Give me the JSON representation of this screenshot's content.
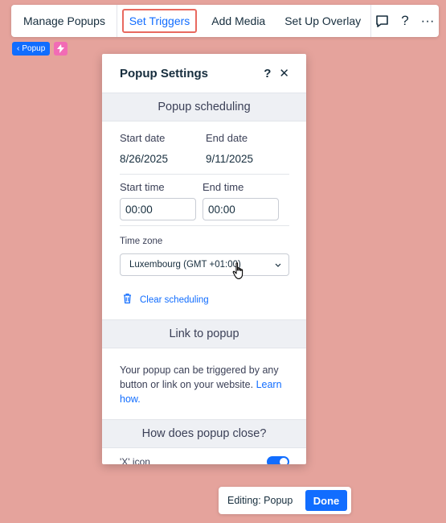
{
  "toolbar": {
    "manage_popups": "Manage Popups",
    "set_triggers": "Set Triggers",
    "add_media": "Add Media",
    "set_up_overlay": "Set Up Overlay",
    "help": "?",
    "more": "···"
  },
  "breadcrumb": {
    "label": "Popup"
  },
  "panel": {
    "title": "Popup Settings",
    "help": "?",
    "close": "✕",
    "scheduling": {
      "heading": "Popup scheduling",
      "start_date_label": "Start date",
      "start_date_value": "8/26/2025",
      "end_date_label": "End date",
      "end_date_value": "9/11/2025",
      "start_time_label": "Start time",
      "start_time_value": "00:00",
      "end_time_label": "End time",
      "end_time_value": "00:00",
      "time_zone_label": "Time zone",
      "time_zone_value": "Luxembourg (GMT +01:00)",
      "clear_label": "Clear scheduling"
    },
    "link": {
      "heading": "Link to popup",
      "description": "Your popup can be triggered by any button or link on your website.",
      "learn_how": "Learn how."
    },
    "close_section": {
      "heading": "How does popup close?",
      "x_icon_label": "'X' icon"
    }
  },
  "editbar": {
    "label": "Editing: Popup",
    "done": "Done"
  },
  "colors": {
    "accent": "#116dff",
    "background": "#e5a39c",
    "highlight": "#e8695f",
    "bolt": "#f26bb5"
  }
}
